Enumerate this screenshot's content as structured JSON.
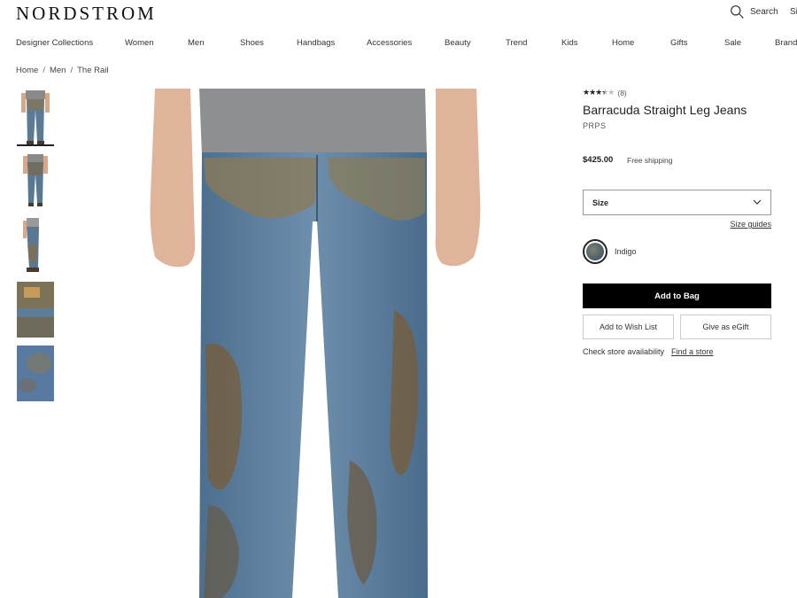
{
  "header": {
    "logo": "NORDSTROM",
    "search_label": "Search",
    "signin_label": "Si"
  },
  "nav": [
    "Designer Collections",
    "Women",
    "Men",
    "Shoes",
    "Handbags",
    "Accessories",
    "Beauty",
    "Trend",
    "Kids",
    "Home",
    "Gifts",
    "Sale",
    "Brand"
  ],
  "breadcrumb": [
    "Home",
    "Men",
    "The Rail"
  ],
  "breadcrumb_separator": "/",
  "product": {
    "rating": 3.5,
    "stars": "★★★",
    "half_star": "★",
    "empty_stars": "★",
    "review_count": "(8)",
    "title": "Barracuda Straight Leg Jeans",
    "brand": "PRPS",
    "price": "$425.00",
    "shipping": "Free shipping",
    "size_label": "Size",
    "size_guides": "Size guides",
    "color_name": "Indigo",
    "add_to_bag": "Add to Bag",
    "add_to_wishlist": "Add to Wish List",
    "give_egift": "Give as eGift",
    "check_store": "Check store availability",
    "find_store": "Find a store"
  },
  "colors": {
    "primary_button": "#000000",
    "denim": "#4f7191",
    "mud": "#8a6d3c"
  }
}
